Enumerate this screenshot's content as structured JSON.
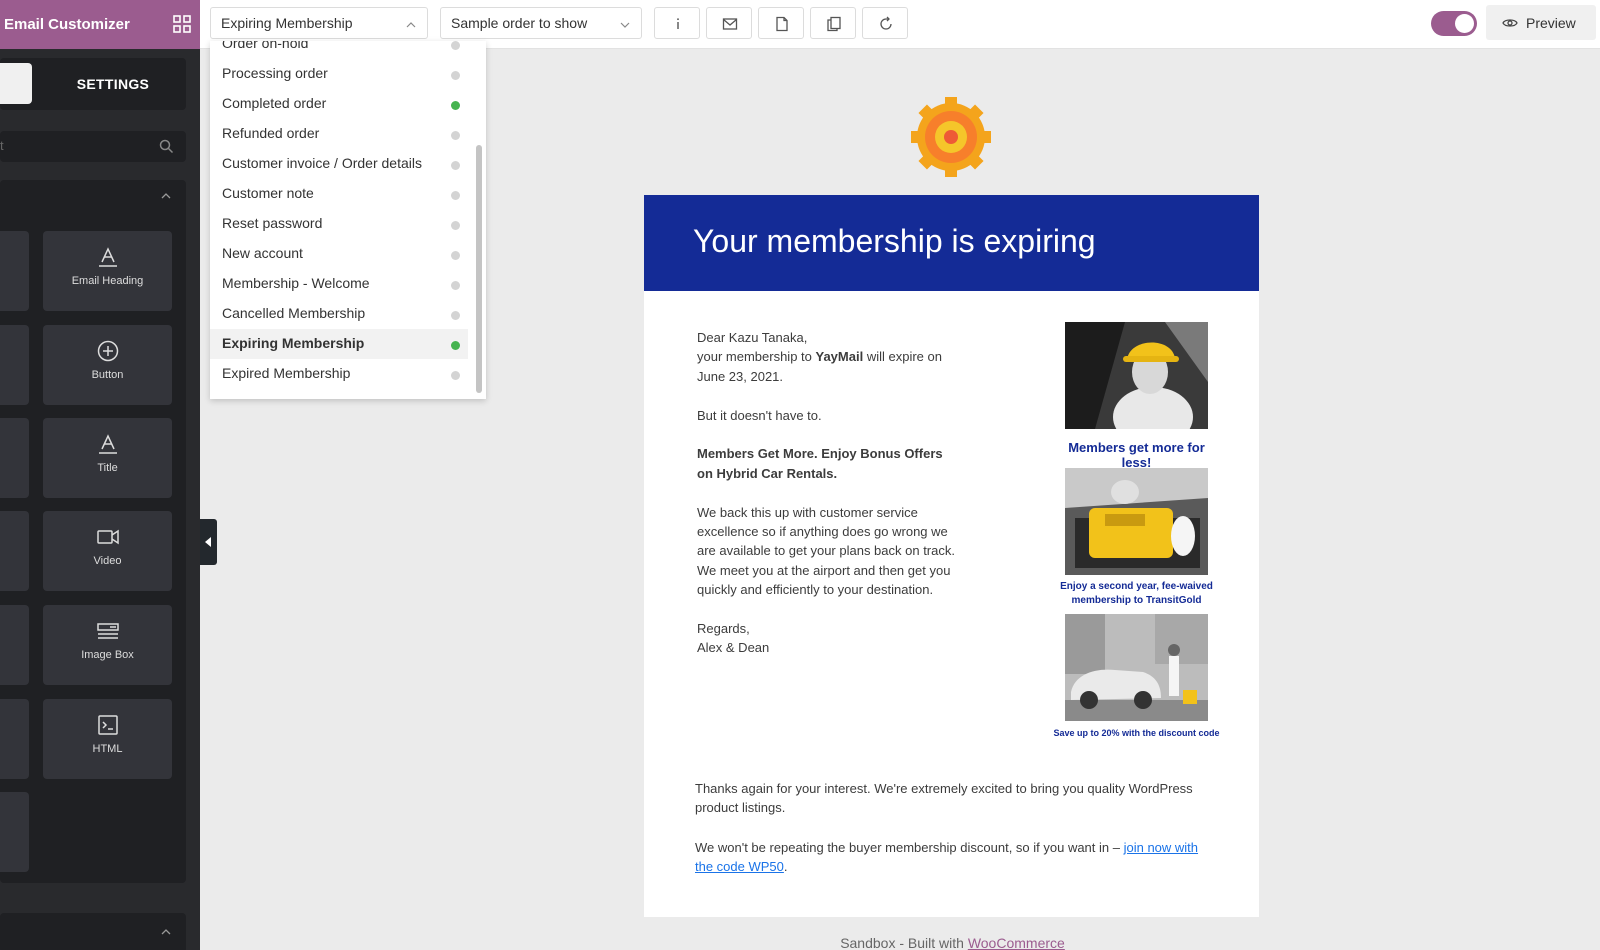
{
  "sidebar": {
    "title": "Email Customizer",
    "settings_tab": "SETTINGS",
    "search_placeholder": "t",
    "widgets": [
      {
        "label": "Email Heading",
        "icon": "heading-icon"
      },
      {
        "label": "Button",
        "icon": "plus-circle-icon"
      },
      {
        "label": "Title",
        "icon": "title-icon"
      },
      {
        "label": "Video",
        "icon": "video-icon"
      },
      {
        "label": "Image Box",
        "icon": "image-box-icon"
      },
      {
        "label": "HTML",
        "icon": "code-icon"
      }
    ]
  },
  "toolbar": {
    "template_select": "Expiring Membership",
    "order_select": "Sample order to show",
    "buttons": [
      "info-icon",
      "mail-icon",
      "document-icon",
      "copy-icon",
      "reset-icon"
    ],
    "toggle_on": true,
    "preview_label": "Preview"
  },
  "dropdown": {
    "items": [
      {
        "label": "Order on-hold",
        "active": false
      },
      {
        "label": "Processing order",
        "active": false
      },
      {
        "label": "Completed order",
        "active": true
      },
      {
        "label": "Refunded order",
        "active": false
      },
      {
        "label": "Customer invoice / Order details",
        "active": false
      },
      {
        "label": "Customer note",
        "active": false
      },
      {
        "label": "Reset password",
        "active": false
      },
      {
        "label": "New account",
        "active": false
      },
      {
        "label": "Membership - Welcome",
        "active": false
      },
      {
        "label": "Cancelled Membership",
        "active": false
      },
      {
        "label": "Expiring Membership",
        "active": true,
        "selected": true
      },
      {
        "label": "Expired Membership",
        "active": false
      }
    ]
  },
  "email": {
    "heading": "Your membership is expiring",
    "greeting": "Dear Kazu Tanaka,",
    "line1_pre": "your membership to ",
    "brand": "YayMail",
    "line1_post": " will expire on June 23, 2021.",
    "line2": "But it doesn't have to.",
    "bold_offer": "Members Get More. Enjoy Bonus Offers on Hybrid Car Rentals.",
    "para3": "We back this up with customer service excellence so if anything does go wrong we are available to get your plans back on track. We meet you at the airport and then get you quickly and efficiently to your destination.",
    "regards": "Regards,",
    "signoff": "Alex & Dean",
    "ads": [
      {
        "caption": "Members get more for less!"
      },
      {
        "caption": "Enjoy a second year, fee-waived membership to TransitGold"
      },
      {
        "caption": "Save up to 20% with the discount code"
      }
    ],
    "footer1": "Thanks again for your interest. We're extremely excited to bring you quality WordPress product listings.",
    "footer2_pre": "We won't be repeating the buyer membership discount, so if you want in – ",
    "footer2_link": "join now with the code WP50",
    "footer2_post": "."
  },
  "page_footer": {
    "text": "Sandbox - Built with ",
    "link": "WooCommerce"
  },
  "colors": {
    "brand": "#9b5c8f",
    "email_header": "#142b96",
    "status_active": "#46b450"
  }
}
